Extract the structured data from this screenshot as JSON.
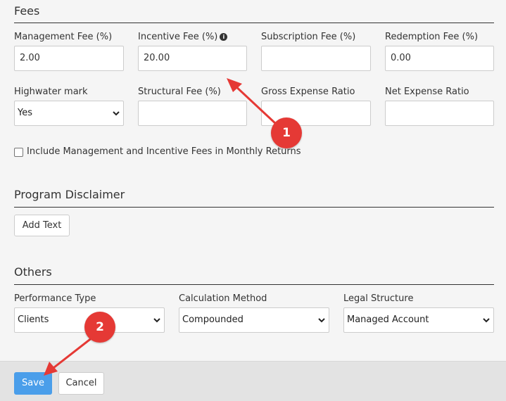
{
  "fees": {
    "title": "Fees",
    "management_fee": {
      "label": "Management Fee (%)",
      "value": "2.00"
    },
    "incentive_fee": {
      "label": "Incentive Fee (%)",
      "value": "20.00",
      "info_icon": "info-circle-icon"
    },
    "subscription_fee": {
      "label": "Subscription Fee (%)",
      "value": ""
    },
    "redemption_fee": {
      "label": "Redemption Fee (%)",
      "value": "0.00"
    },
    "highwater_mark": {
      "label": "Highwater mark",
      "value": "Yes"
    },
    "structural_fee": {
      "label": "Structural Fee (%)",
      "value": ""
    },
    "gross_expense_ratio": {
      "label": "Gross Expense Ratio",
      "value": ""
    },
    "net_expense_ratio": {
      "label": "Net Expense Ratio",
      "value": ""
    },
    "include_fees_checkbox": {
      "label": "Include Management and Incentive Fees in Monthly Returns",
      "checked": false
    }
  },
  "disclaimer": {
    "title": "Program Disclaimer",
    "add_text_label": "Add Text"
  },
  "others": {
    "title": "Others",
    "performance_type": {
      "label": "Performance Type",
      "value": "Clients"
    },
    "calculation_method": {
      "label": "Calculation Method",
      "value": "Compounded"
    },
    "legal_structure": {
      "label": "Legal Structure",
      "value": "Managed Account"
    }
  },
  "footer": {
    "save_label": "Save",
    "cancel_label": "Cancel"
  },
  "annotations": {
    "badge1": "1",
    "badge2": "2",
    "color": "#e53935"
  },
  "colors": {
    "primary_button": "#4a9eea",
    "background": "#f5f5f5",
    "footer": "#e3e3e3"
  }
}
